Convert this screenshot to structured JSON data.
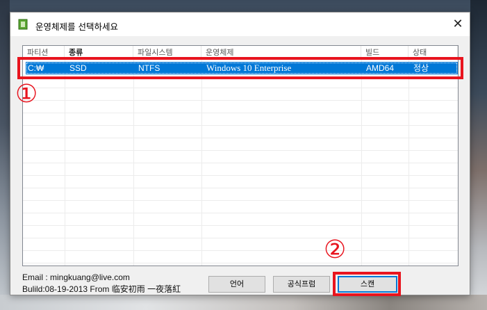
{
  "window": {
    "title": "운영체제를 선택하세요",
    "close_glyph": "✕",
    "app_icon": "green-window-icon"
  },
  "list": {
    "columns": [
      "파티션",
      "종류",
      "파일시스템",
      "운영체제",
      "빌드",
      "상태"
    ],
    "rows": [
      {
        "partition": "C:₩",
        "type": "SSD",
        "filesystem": "NTFS",
        "os": "Windows 10 Enterprise",
        "build": "AMD64",
        "status": "정상",
        "selected": true
      }
    ]
  },
  "annotations": {
    "marker_1": "①",
    "marker_2": "②",
    "color": "#e8141e"
  },
  "footer": {
    "email": "Email : mingkuang@live.com",
    "build": "Bulild:08-19-2013 From 临安初雨 一夜落紅"
  },
  "buttons": {
    "language": "언어",
    "formula": "공식프럼",
    "scan": "스캔"
  },
  "colors": {
    "selection": "#0078d7",
    "annotation_red": "#e8141e"
  }
}
